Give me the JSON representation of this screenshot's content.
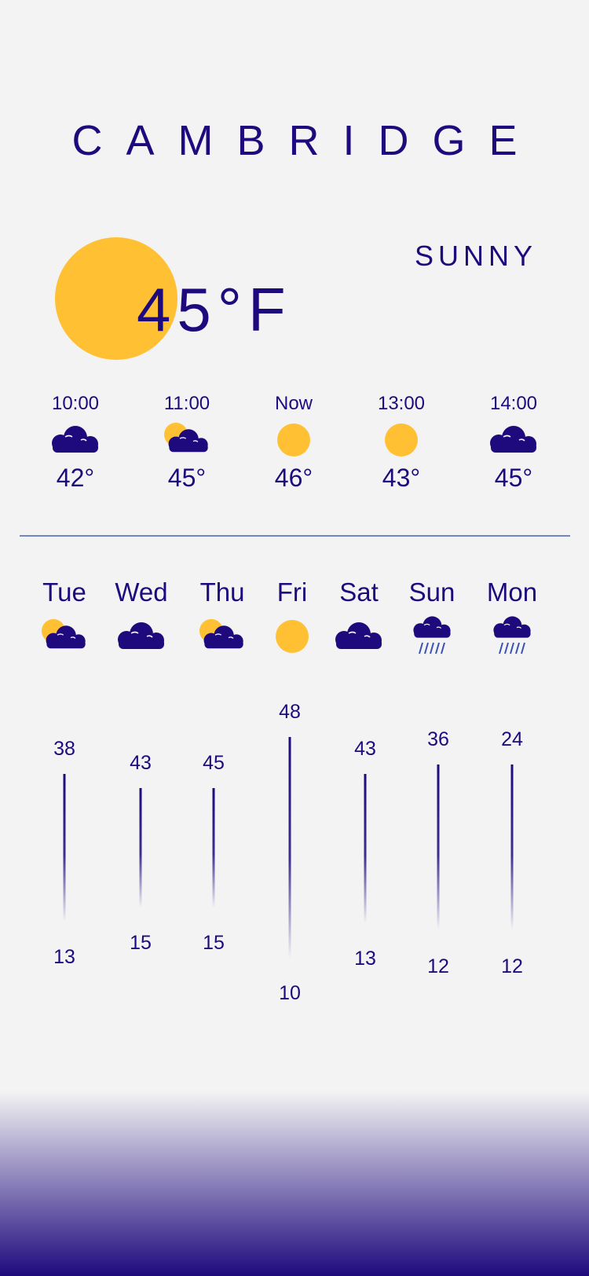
{
  "city": "CAMBRIDGE",
  "current": {
    "temp": "45°F",
    "condition": "SUNNY",
    "icon": "sun-icon"
  },
  "colors": {
    "primary": "#1f0a7d",
    "sun": "#ffc033",
    "divider": "#6e86c4",
    "background": "#f3f3f4"
  },
  "hourly": [
    {
      "time": "10:00",
      "icon": "cloud",
      "temp": "42°"
    },
    {
      "time": "11:00",
      "icon": "partly-cloudy",
      "temp": "45°"
    },
    {
      "time": "Now",
      "icon": "sun",
      "temp": "46°"
    },
    {
      "time": "13:00",
      "icon": "sun",
      "temp": "43°"
    },
    {
      "time": "14:00",
      "icon": "cloud",
      "temp": "45°"
    }
  ],
  "daily": [
    {
      "day": "Tue",
      "icon": "partly-cloudy",
      "high": "38",
      "low": "13"
    },
    {
      "day": "Wed",
      "icon": "cloud",
      "high": "43",
      "low": "15"
    },
    {
      "day": "Thu",
      "icon": "partly-cloudy",
      "high": "45",
      "low": "15"
    },
    {
      "day": "Fri",
      "icon": "sun",
      "high": "48",
      "low": "10"
    },
    {
      "day": "Sat",
      "icon": "cloud",
      "high": "43",
      "low": "13"
    },
    {
      "day": "Sun",
      "icon": "rain",
      "high": "36",
      "low": "12"
    },
    {
      "day": "Mon",
      "icon": "rain",
      "high": "24",
      "low": "12"
    }
  ]
}
